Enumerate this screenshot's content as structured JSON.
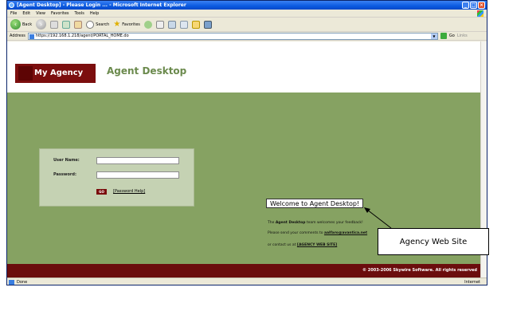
{
  "window": {
    "title": "[Agent Desktop] - Please Login ... - Microsoft Internet Explorer",
    "minimize": "_",
    "maximize": "□",
    "close": "×"
  },
  "menu": [
    "File",
    "Edit",
    "View",
    "Favorites",
    "Tools",
    "Help"
  ],
  "toolbar": {
    "back_label": "Back",
    "search_label": "Search",
    "favorites_label": "Favorites"
  },
  "address": {
    "label": "Address",
    "value": "https://192.168.1.218/agent/PORTAL_HOME.do",
    "go_label": "Go",
    "links_label": "Links"
  },
  "header": {
    "logo_text": "My Agency",
    "app_title": "Agent Desktop"
  },
  "login": {
    "username_label": "User Name:",
    "password_label": "Password:",
    "username_value": "",
    "password_value": "",
    "go_button": "GO",
    "password_help": "[Password Help]"
  },
  "welcome": {
    "heading": "Welcome to Agent Desktop!",
    "line1_pre": "The",
    "line1_bold": "Agent Desktop",
    "line1_post": "team welcomes your feedback!",
    "line2_pre": "Please send your comments to",
    "email": "aalfaro@avantica.net",
    "line3_pre": "or contact us at",
    "site_link": "[AGENCY WEB SITE]"
  },
  "footer": {
    "copyright": "© 2003-2006 Skywire Software. All rights reserved"
  },
  "status": {
    "left": "Done",
    "zone": "Internet"
  },
  "callout": {
    "text": "Agency Web Site"
  }
}
